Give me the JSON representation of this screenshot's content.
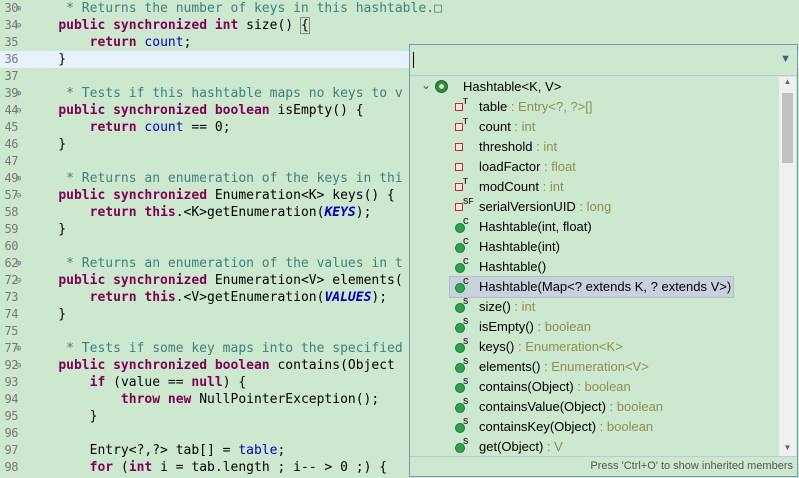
{
  "editor": {
    "lines": [
      {
        "num": "30",
        "fold": "⊕",
        "segs": [
          {
            "t": "     * Returns the number of keys in this hashtable.",
            "c": "cm"
          },
          {
            "t": "□",
            "c": "cm"
          }
        ]
      },
      {
        "num": "34",
        "fold": "⊖",
        "segs": [
          {
            "t": "    "
          },
          {
            "t": "public synchronized int",
            "c": "kw"
          },
          {
            "t": " size() "
          },
          {
            "t": "{",
            "c": "brk"
          }
        ]
      },
      {
        "num": "35",
        "fold": "",
        "segs": [
          {
            "t": "        "
          },
          {
            "t": "return",
            "c": "kw"
          },
          {
            "t": " "
          },
          {
            "t": "count",
            "c": "fld"
          },
          {
            "t": ";"
          }
        ]
      },
      {
        "num": "36",
        "fold": "",
        "current": true,
        "segs": [
          {
            "t": "    }"
          }
        ]
      },
      {
        "num": "37",
        "fold": "",
        "segs": []
      },
      {
        "num": "39",
        "fold": "⊕",
        "segs": [
          {
            "t": "     * Tests if this hashtable maps no keys to v",
            "c": "cm"
          }
        ]
      },
      {
        "num": "44",
        "fold": "⊖",
        "segs": [
          {
            "t": "    "
          },
          {
            "t": "public synchronized boolean",
            "c": "kw"
          },
          {
            "t": " isEmpty() {"
          }
        ]
      },
      {
        "num": "45",
        "fold": "",
        "segs": [
          {
            "t": "        "
          },
          {
            "t": "return",
            "c": "kw"
          },
          {
            "t": " "
          },
          {
            "t": "count",
            "c": "fld"
          },
          {
            "t": " == 0;"
          }
        ]
      },
      {
        "num": "46",
        "fold": "",
        "segs": [
          {
            "t": "    }"
          }
        ]
      },
      {
        "num": "47",
        "fold": "",
        "segs": []
      },
      {
        "num": "49",
        "fold": "⊕",
        "segs": [
          {
            "t": "     * Returns an enumeration of the keys in thi",
            "c": "cm"
          }
        ]
      },
      {
        "num": "57",
        "fold": "⊖",
        "segs": [
          {
            "t": "    "
          },
          {
            "t": "public synchronized",
            "c": "kw"
          },
          {
            "t": " Enumeration<K> keys() {"
          }
        ]
      },
      {
        "num": "58",
        "fold": "",
        "segs": [
          {
            "t": "        "
          },
          {
            "t": "return this",
            "c": "kw"
          },
          {
            "t": ".<K>getEnumeration("
          },
          {
            "t": "KEYS",
            "c": "cst"
          },
          {
            "t": ");"
          }
        ]
      },
      {
        "num": "59",
        "fold": "",
        "segs": [
          {
            "t": "    }"
          }
        ]
      },
      {
        "num": "60",
        "fold": "",
        "segs": []
      },
      {
        "num": "62",
        "fold": "⊕",
        "segs": [
          {
            "t": "     * Returns an enumeration of the values in t",
            "c": "cm"
          }
        ]
      },
      {
        "num": "72",
        "fold": "⊖",
        "segs": [
          {
            "t": "    "
          },
          {
            "t": "public synchronized",
            "c": "kw"
          },
          {
            "t": " Enumeration<V> elements("
          }
        ]
      },
      {
        "num": "73",
        "fold": "",
        "segs": [
          {
            "t": "        "
          },
          {
            "t": "return this",
            "c": "kw"
          },
          {
            "t": ".<V>getEnumeration("
          },
          {
            "t": "VALUES",
            "c": "cst"
          },
          {
            "t": ");"
          }
        ]
      },
      {
        "num": "74",
        "fold": "",
        "segs": [
          {
            "t": "    }"
          }
        ]
      },
      {
        "num": "75",
        "fold": "",
        "segs": []
      },
      {
        "num": "77",
        "fold": "⊕",
        "segs": [
          {
            "t": "     * Tests if some key maps into the specified",
            "c": "cm"
          }
        ]
      },
      {
        "num": "92",
        "fold": "⊖",
        "segs": [
          {
            "t": "    "
          },
          {
            "t": "public synchronized boolean",
            "c": "kw"
          },
          {
            "t": " contains(Object"
          }
        ]
      },
      {
        "num": "93",
        "fold": "",
        "segs": [
          {
            "t": "        "
          },
          {
            "t": "if",
            "c": "kw"
          },
          {
            "t": " ("
          },
          {
            "t": "value",
            "c": ""
          },
          {
            "t": " == "
          },
          {
            "t": "null",
            "c": "kw"
          },
          {
            "t": ") {"
          }
        ]
      },
      {
        "num": "94",
        "fold": "",
        "segs": [
          {
            "t": "            "
          },
          {
            "t": "throw new",
            "c": "kw"
          },
          {
            "t": " NullPointerException();"
          }
        ]
      },
      {
        "num": "95",
        "fold": "",
        "segs": [
          {
            "t": "        }"
          }
        ]
      },
      {
        "num": "96",
        "fold": "",
        "segs": []
      },
      {
        "num": "97",
        "fold": "",
        "segs": [
          {
            "t": "        Entry<?,?> tab[] = "
          },
          {
            "t": "table",
            "c": "fld"
          },
          {
            "t": ";"
          }
        ]
      },
      {
        "num": "98",
        "fold": "",
        "segs": [
          {
            "t": "        "
          },
          {
            "t": "for",
            "c": "kw"
          },
          {
            "t": " ("
          },
          {
            "t": "int",
            "c": "kw"
          },
          {
            "t": " i = tab.length ; i-- > 0 ;) {"
          }
        ]
      }
    ]
  },
  "assist": {
    "root_label": "Hashtable<K, V>",
    "root_chevron": "⌄",
    "dropdown_icon": "▼",
    "footer_hint": "Press 'Ctrl+O' to show inherited members",
    "items": [
      {
        "name": "table",
        "type": " : Entry<?, ?>[]",
        "icon": "field",
        "sup": "T"
      },
      {
        "name": "count",
        "type": " : int",
        "icon": "field",
        "sup": "T"
      },
      {
        "name": "threshold",
        "type": " : int",
        "icon": "field",
        "sup": ""
      },
      {
        "name": "loadFactor",
        "type": " : float",
        "icon": "field",
        "sup": ""
      },
      {
        "name": "modCount",
        "type": " : int",
        "icon": "field",
        "sup": "T"
      },
      {
        "name": "serialVersionUID",
        "type": " : long",
        "icon": "field",
        "sup": "SF"
      },
      {
        "name": "Hashtable(int, float)",
        "type": "",
        "icon": "method",
        "sup": "C"
      },
      {
        "name": "Hashtable(int)",
        "type": "",
        "icon": "method",
        "sup": "C"
      },
      {
        "name": "Hashtable()",
        "type": "",
        "icon": "method",
        "sup": "C"
      },
      {
        "name": "Hashtable(Map<? extends K, ? extends V>)",
        "type": "",
        "icon": "method",
        "sup": "C",
        "selected": true
      },
      {
        "name": "size()",
        "type": " : int",
        "icon": "method",
        "sup": "S"
      },
      {
        "name": "isEmpty()",
        "type": " : boolean",
        "icon": "method",
        "sup": "S"
      },
      {
        "name": "keys()",
        "type": " : Enumeration<K>",
        "icon": "method",
        "sup": "S"
      },
      {
        "name": "elements()",
        "type": " : Enumeration<V>",
        "icon": "method",
        "sup": "S"
      },
      {
        "name": "contains(Object)",
        "type": " : boolean",
        "icon": "method",
        "sup": "S"
      },
      {
        "name": "containsValue(Object)",
        "type": " : boolean",
        "icon": "method",
        "sup": "S"
      },
      {
        "name": "containsKey(Object)",
        "type": " : boolean",
        "icon": "method",
        "sup": "S"
      },
      {
        "name": "get(Object)",
        "type": " : V",
        "icon": "method",
        "sup": "S"
      }
    ]
  }
}
